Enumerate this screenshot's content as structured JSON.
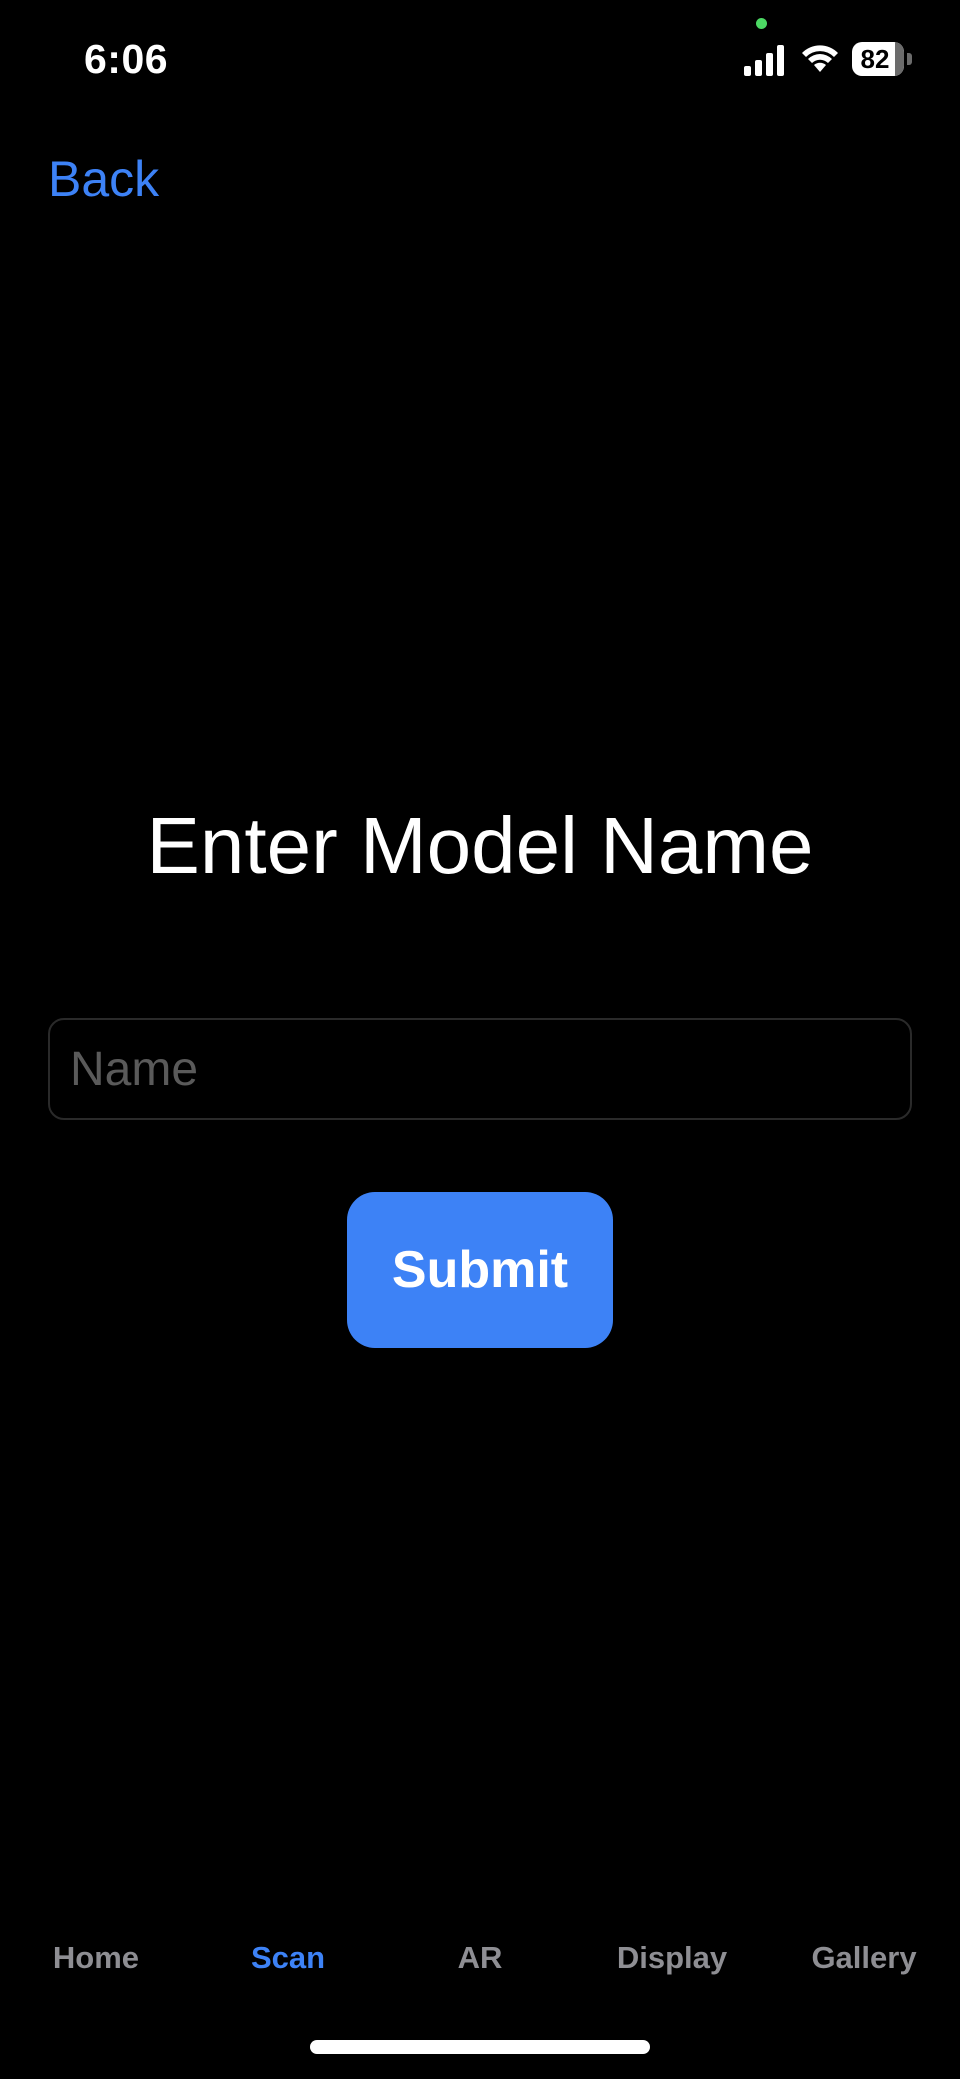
{
  "status_bar": {
    "time": "6:06",
    "battery_level": "82",
    "icons": [
      "cellular-signal-icon",
      "wifi-icon",
      "battery-icon"
    ],
    "privacy_indicator_color": "#4cd964"
  },
  "nav": {
    "back_label": "Back"
  },
  "form": {
    "title": "Enter Model Name",
    "name_placeholder": "Name",
    "name_value": "",
    "submit_label": "Submit"
  },
  "tab_bar": {
    "active_tab": "Scan",
    "tabs": [
      {
        "label": "Home"
      },
      {
        "label": "Scan"
      },
      {
        "label": "AR"
      },
      {
        "label": "Display"
      },
      {
        "label": "Gallery"
      }
    ]
  },
  "colors": {
    "accent": "#3d82f6",
    "background": "#000000",
    "tab_inactive": "#8e8e93",
    "placeholder": "#5a5a5a"
  }
}
